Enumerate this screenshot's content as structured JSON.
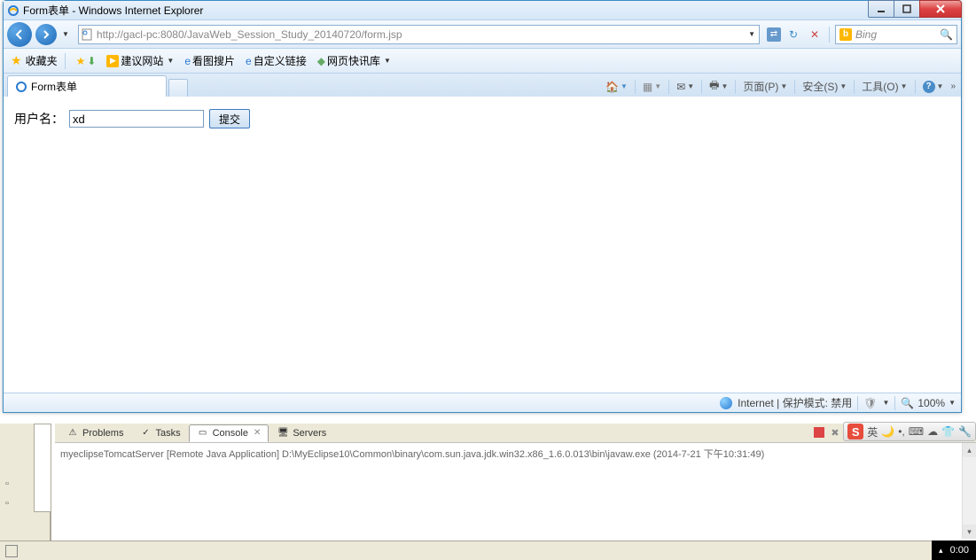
{
  "window": {
    "title": "Form表单 - Windows Internet Explorer"
  },
  "nav": {
    "url": "http://gacl-pc:8080/JavaWeb_Session_Study_20140720/form.jsp",
    "search_engine": "Bing"
  },
  "favorites": {
    "label": "收藏夹",
    "items": [
      "建议网站",
      "看图搜片",
      "自定义链接",
      "网页快讯库"
    ]
  },
  "tab": {
    "title": "Form表单"
  },
  "tabtools": {
    "page": "页面(P)",
    "safety": "安全(S)",
    "tools": "工具(O)"
  },
  "form": {
    "label": "用户名：",
    "value": "xd",
    "submit": "提交"
  },
  "status": {
    "zone": "Internet | 保护模式: 禁用",
    "zoom": "100%"
  },
  "eclipse": {
    "tabs": [
      "Problems",
      "Tasks",
      "Console",
      "Servers"
    ],
    "content": "myeclipseTomcatServer [Remote Java Application] D:\\MyEclipse10\\Common\\binary\\com.sun.java.jdk.win32.x86_1.6.0.013\\bin\\javaw.exe (2014-7-21 下午10:31:49)"
  },
  "ime": {
    "lang": "英"
  },
  "taskbar": {
    "time": "0:00"
  }
}
